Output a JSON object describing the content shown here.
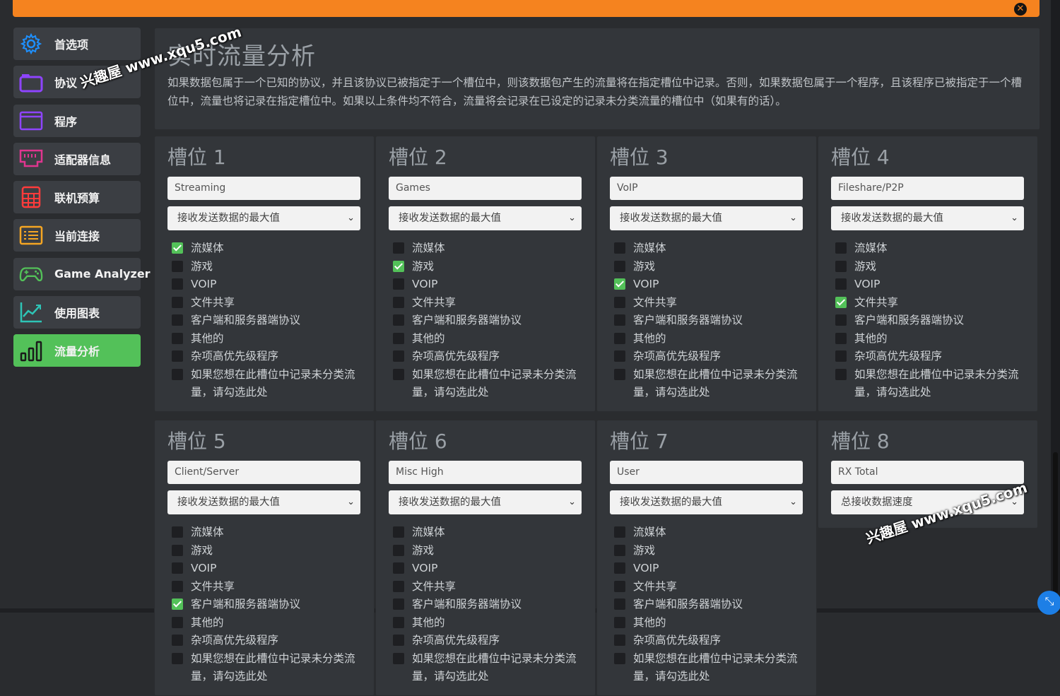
{
  "header": {
    "close_icon": "✕"
  },
  "sidebar": {
    "items": [
      {
        "label": "首选项",
        "icon": "gear-icon",
        "color": "#1e90ff",
        "active": false
      },
      {
        "label": "协议",
        "icon": "folder-icon",
        "color": "#8e44ff",
        "active": false
      },
      {
        "label": "程序",
        "icon": "window-icon",
        "color": "#8e44ff",
        "active": false
      },
      {
        "label": "适配器信息",
        "icon": "network-port-icon",
        "color": "#e0358f",
        "active": false
      },
      {
        "label": "联机预算",
        "icon": "calculator-icon",
        "color": "#ff3b3b",
        "active": false
      },
      {
        "label": "当前连接",
        "icon": "list-icon",
        "color": "#f5a623",
        "active": false
      },
      {
        "label": "Game Analyzer",
        "icon": "gamepad-icon",
        "color": "#53c159",
        "active": false
      },
      {
        "label": "使用图表",
        "icon": "line-chart-icon",
        "color": "#2ec4b6",
        "active": false
      },
      {
        "label": "流量分析",
        "icon": "bar-chart-icon",
        "color": "#1a1a1a",
        "active": true
      }
    ]
  },
  "main": {
    "title": "实时流量分析",
    "description": "如果数据包属于一个已知的协议，并且该协议已被指定于一个槽位中，则该数据包产生的流量将在指定槽位中记录。否则，如果数据包属于一个程序，且该程序已被指定于一个槽位中，流量也将记录在指定槽位中。如果以上条件均不符合，流量将会记录在已设定的记录未分类流量的槽位中（如果有的话）。"
  },
  "slots": [
    {
      "title": "槽位 1",
      "name": "Streaming",
      "metric": "接收发送数据的最大值",
      "checked": [
        0
      ]
    },
    {
      "title": "槽位 2",
      "name": "Games",
      "metric": "接收发送数据的最大值",
      "checked": [
        1
      ]
    },
    {
      "title": "槽位 3",
      "name": "VoIP",
      "metric": "接收发送数据的最大值",
      "checked": [
        2
      ]
    },
    {
      "title": "槽位 4",
      "name": "Fileshare/P2P",
      "metric": "接收发送数据的最大值",
      "checked": [
        3
      ]
    },
    {
      "title": "槽位 5",
      "name": "Client/Server",
      "metric": "接收发送数据的最大值",
      "checked": [
        4
      ]
    },
    {
      "title": "槽位 6",
      "name": "Misc High",
      "metric": "接收发送数据的最大值",
      "checked": []
    },
    {
      "title": "槽位 7",
      "name": "User",
      "metric": "接收发送数据的最大值",
      "checked": []
    },
    {
      "title": "槽位 8",
      "name": "RX Total",
      "metric": "总接收数据速度",
      "checked": []
    }
  ],
  "categories": [
    "流媒体",
    "游戏",
    "VOIP",
    "文件共享",
    "客户端和服务器端协议",
    "其他的",
    "杂项高优先级程序",
    "如果您想在此槽位中记录未分类流量，请勾选此处"
  ],
  "watermarks": [
    "兴趣屋 www.xqu5.com",
    "兴趣屋 www.xqu5.com"
  ],
  "colors": {
    "accent": "#f5831f",
    "active": "#53c159",
    "panel": "#33363a",
    "background": "#2a2c2f"
  }
}
